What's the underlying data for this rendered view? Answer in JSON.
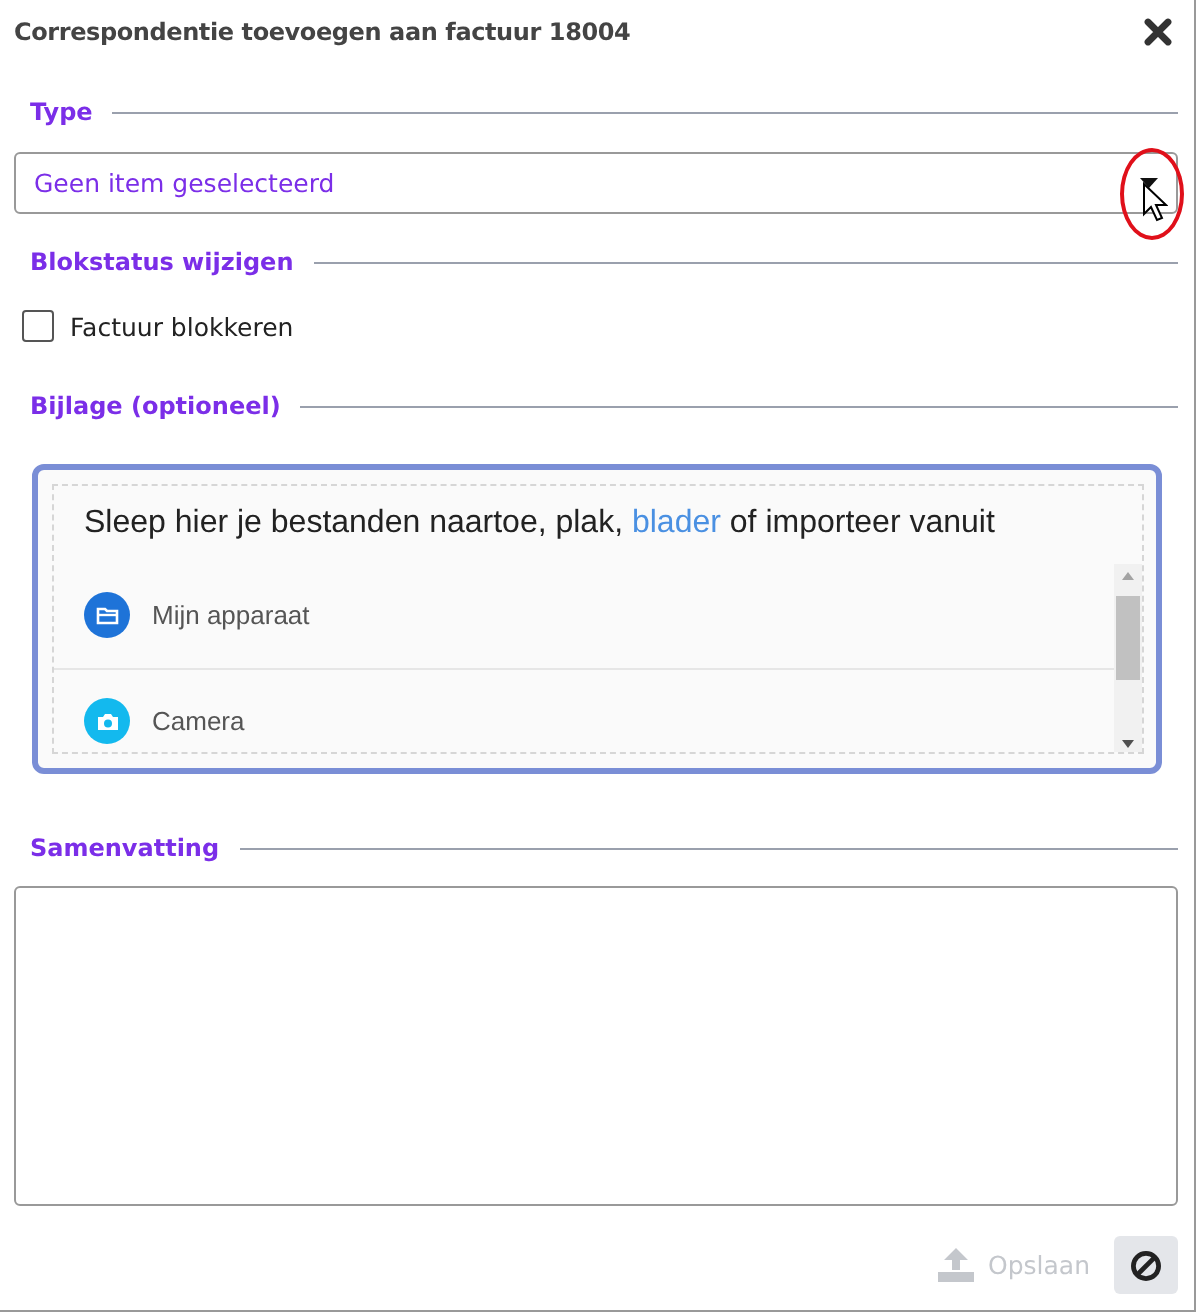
{
  "dialog": {
    "title": "Correspondentie toevoegen aan factuur 18004"
  },
  "type_section": {
    "legend": "Type",
    "select": {
      "placeholder": "Geen item geselecteerd"
    }
  },
  "block_section": {
    "legend": "Blokstatus wijzigen",
    "checkbox": {
      "label": "Factuur blokkeren",
      "checked": false
    }
  },
  "attachment_section": {
    "legend": "Bijlage (optioneel)",
    "prompt_before": "Sleep hier je bestanden naartoe, plak, ",
    "prompt_link": "blader",
    "prompt_after": " of importeer vanuit",
    "sources": [
      {
        "label": "Mijn apparaat",
        "kind": "folder"
      },
      {
        "label": "Camera",
        "kind": "camera"
      }
    ]
  },
  "summary_section": {
    "legend": "Samenvatting"
  },
  "footer": {
    "save": {
      "label": "Opslaan",
      "disabled": true
    }
  }
}
